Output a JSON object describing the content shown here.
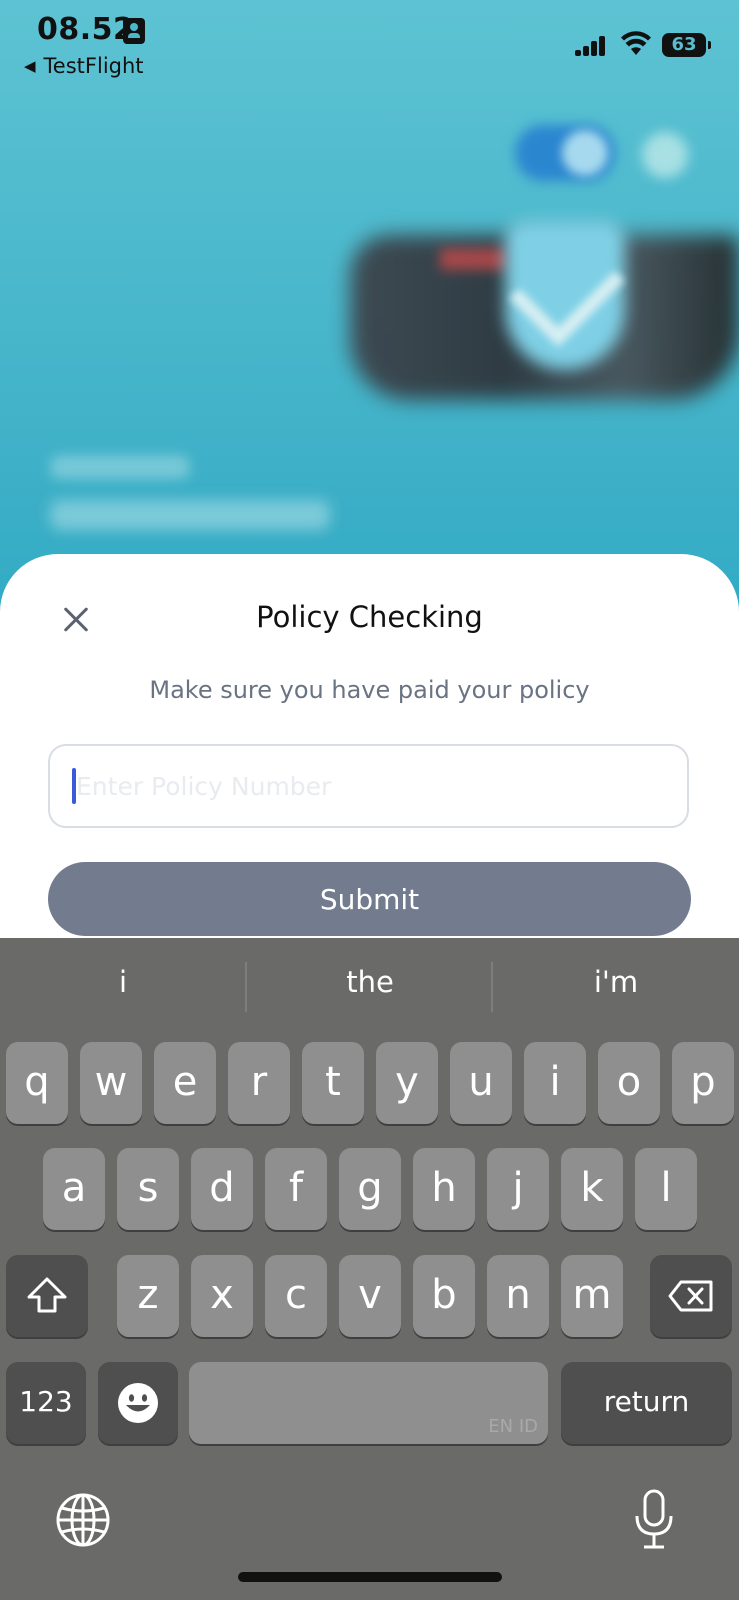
{
  "status_bar": {
    "time": "08.52",
    "back_app": "TestFlight",
    "battery": "63"
  },
  "sheet": {
    "title": "Policy Checking",
    "subtitle": "Make sure you have paid your policy",
    "input_placeholder": "Enter Policy Number",
    "input_value": "",
    "submit_label": "Submit"
  },
  "keyboard": {
    "suggestions": [
      "i",
      "the",
      "i'm"
    ],
    "row1": [
      "q",
      "w",
      "e",
      "r",
      "t",
      "y",
      "u",
      "i",
      "o",
      "p"
    ],
    "row2": [
      "a",
      "s",
      "d",
      "f",
      "g",
      "h",
      "j",
      "k",
      "l"
    ],
    "row3": [
      "z",
      "x",
      "c",
      "v",
      "b",
      "n",
      "m"
    ],
    "numbers_label": "123",
    "return_label": "return",
    "space_language": "EN ID"
  },
  "colors": {
    "accent_blue": "#2a9fbf",
    "submit_bg": "#737c8f",
    "keyboard_bg": "#6a6a69",
    "key_bg": "#8f8f8f"
  }
}
